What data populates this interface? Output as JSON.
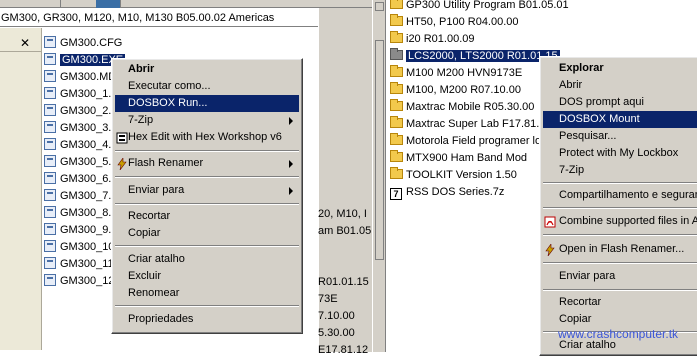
{
  "left": {
    "path": "GM300, GR300, M120, M10, M130 B05.00.02 Americas",
    "files": [
      "GM300.CFG",
      "GM300.EXE",
      "GM300.MD",
      "GM300_1.",
      "GM300_2.",
      "GM300_3.",
      "GM300_4.",
      "GM300_5.",
      "GM300_6.",
      "GM300_7.",
      "GM300_8.",
      "GM300_9.",
      "GM300_10",
      "GM300_11",
      "GM300_12"
    ],
    "background_fragments": [
      "20, M10, I",
      "am B01.05",
      "R01.01.15",
      "73E",
      "7.10.00",
      "5.30.00",
      "E17.81.12"
    ]
  },
  "left_menu": {
    "items": [
      "Abrir",
      "Executar como...",
      "DOSBOX Run...",
      "7-Zip",
      "Hex Edit with Hex Workshop v6",
      "Flash Renamer",
      "Enviar para",
      "Recortar",
      "Copiar",
      "Criar atalho",
      "Excluir",
      "Renomear",
      "Propriedades"
    ]
  },
  "right": {
    "folders": [
      "GP300 Utility Program B01.05.01",
      "HT50, P100 R04.00.00",
      "i20 R01.00.09",
      "LCS2000, LTS2000 R01.01.15",
      "M100 M200 HVN9173E",
      "M100, M200 R07.10.00",
      "Maxtrac Mobile R05.30.00",
      "Maxtrac Super Lab F17.81.",
      "Motorola Field programer lo",
      "MTX900 Ham Band Mod",
      "TOOLKIT Version 1.50"
    ],
    "zip_file": "RSS DOS Series.7z"
  },
  "right_menu": {
    "items": [
      "Explorar",
      "Abrir",
      "DOS prompt aqui",
      "DOSBOX Mount",
      "Pesquisar...",
      "Protect with My Lockbox",
      "7-Zip",
      "Compartilhamento e segurança",
      "Combine supported files in Ac",
      "Open in Flash Renamer...",
      "Enviar para",
      "Recortar",
      "Copiar",
      "Criar atalho"
    ]
  },
  "watermark": "www.crashcomputer.tk",
  "colors": {
    "highlight": "#0a246a",
    "menu_bg": "#d4d0c8",
    "watermark": "#3a55d8"
  }
}
